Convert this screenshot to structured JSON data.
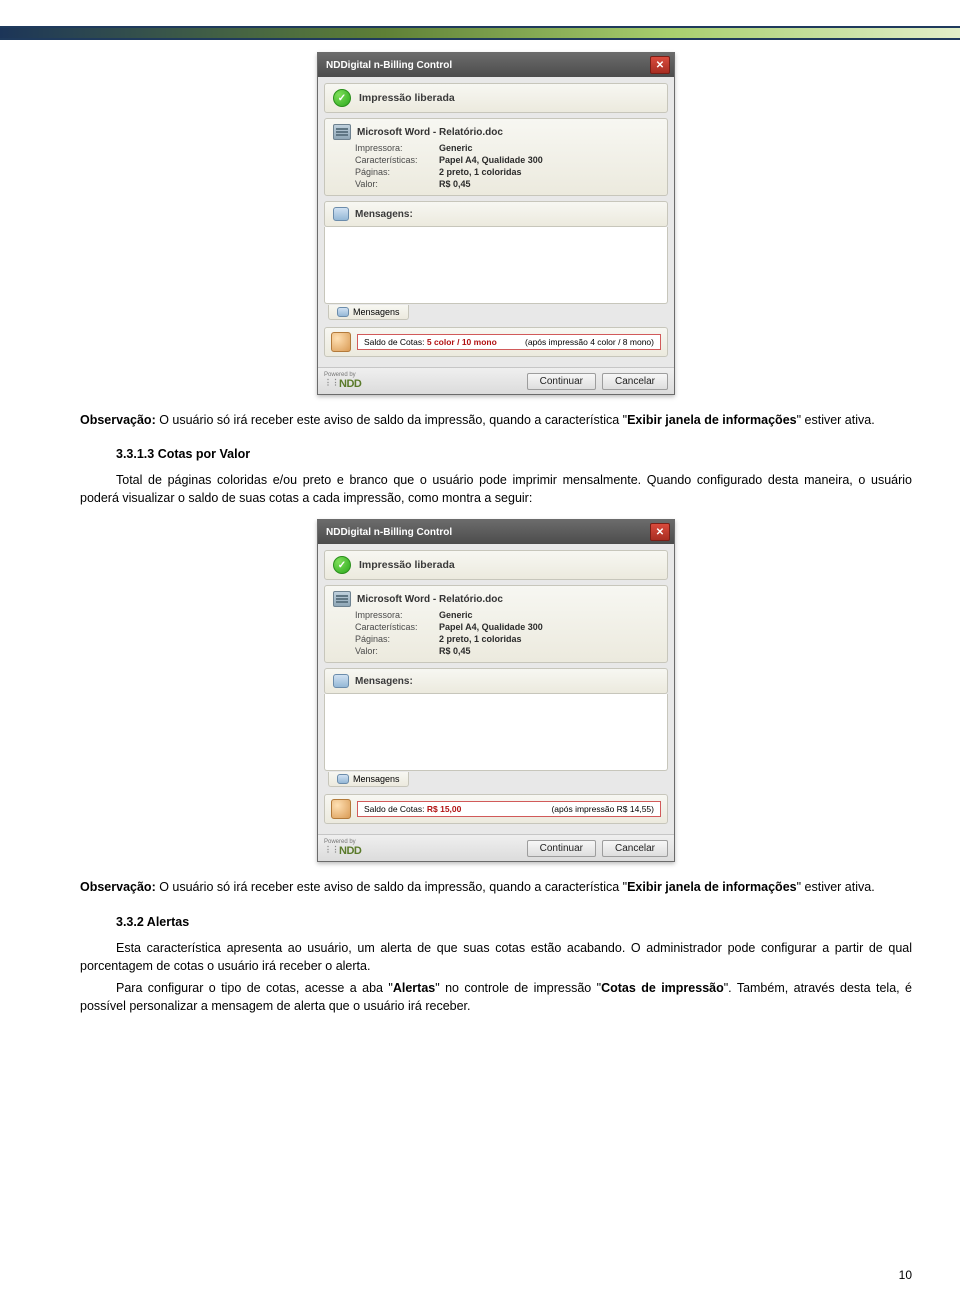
{
  "dialog": {
    "title": "NDDigital n-Billing Control",
    "status": "Impressão liberada",
    "filename": "Microsoft Word - Relatório.doc",
    "rows": {
      "impressora_k": "Impressora:",
      "impressora_v": "Generic",
      "carac_k": "Características:",
      "carac_v": "Papel A4, Qualidade 300",
      "paginas_k": "Páginas:",
      "paginas_v": "2 preto, 1 coloridas",
      "valor_k": "Valor:",
      "valor_v": "R$ 0,45"
    },
    "mensagens_label": "Mensagens:",
    "mensagens_tab": "Mensagens",
    "saldo_label": "Saldo de Cotas:",
    "saldo1": {
      "value": "5 color / 10 mono",
      "after": "(após impressão 4 color / 8 mono)"
    },
    "saldo2": {
      "value": "R$ 15,00",
      "after": "(após impressão R$ 14,55)"
    },
    "brand_prefix": "Powered by",
    "brand": "NDD",
    "btn_continuar": "Continuar",
    "btn_cancelar": "Cancelar"
  },
  "text": {
    "obs_label": "Observação:",
    "obs1_a": " O usuário só irá receber este aviso de saldo da impressão, quando a característica \"",
    "obs_bold": "Exibir janela de informações",
    "obs1_b": "\" estiver ativa.",
    "h3313": "3.3.1.3    Cotas por Valor",
    "p2": "Total de páginas coloridas e/ou preto e branco que o usuário pode imprimir mensalmente. Quando configurado desta maneira, o usuário poderá visualizar o saldo de suas cotas a cada impressão, como montra a seguir:",
    "h332": "3.3.2    Alertas",
    "p3": "Esta característica apresenta ao usuário, um alerta de que suas cotas estão acabando. O administrador pode configurar a partir de qual porcentagem de cotas o usuário irá receber o alerta.",
    "p4_a": "Para configurar o tipo de cotas, acesse a aba \"",
    "p4_b1": "Alertas",
    "p4_c": "\" no controle de impressão \"",
    "p4_b2": "Cotas de impressão",
    "p4_d": "\". Também, através desta tela, é possível personalizar a mensagem de alerta que o usuário irá receber."
  },
  "page_number": "10"
}
